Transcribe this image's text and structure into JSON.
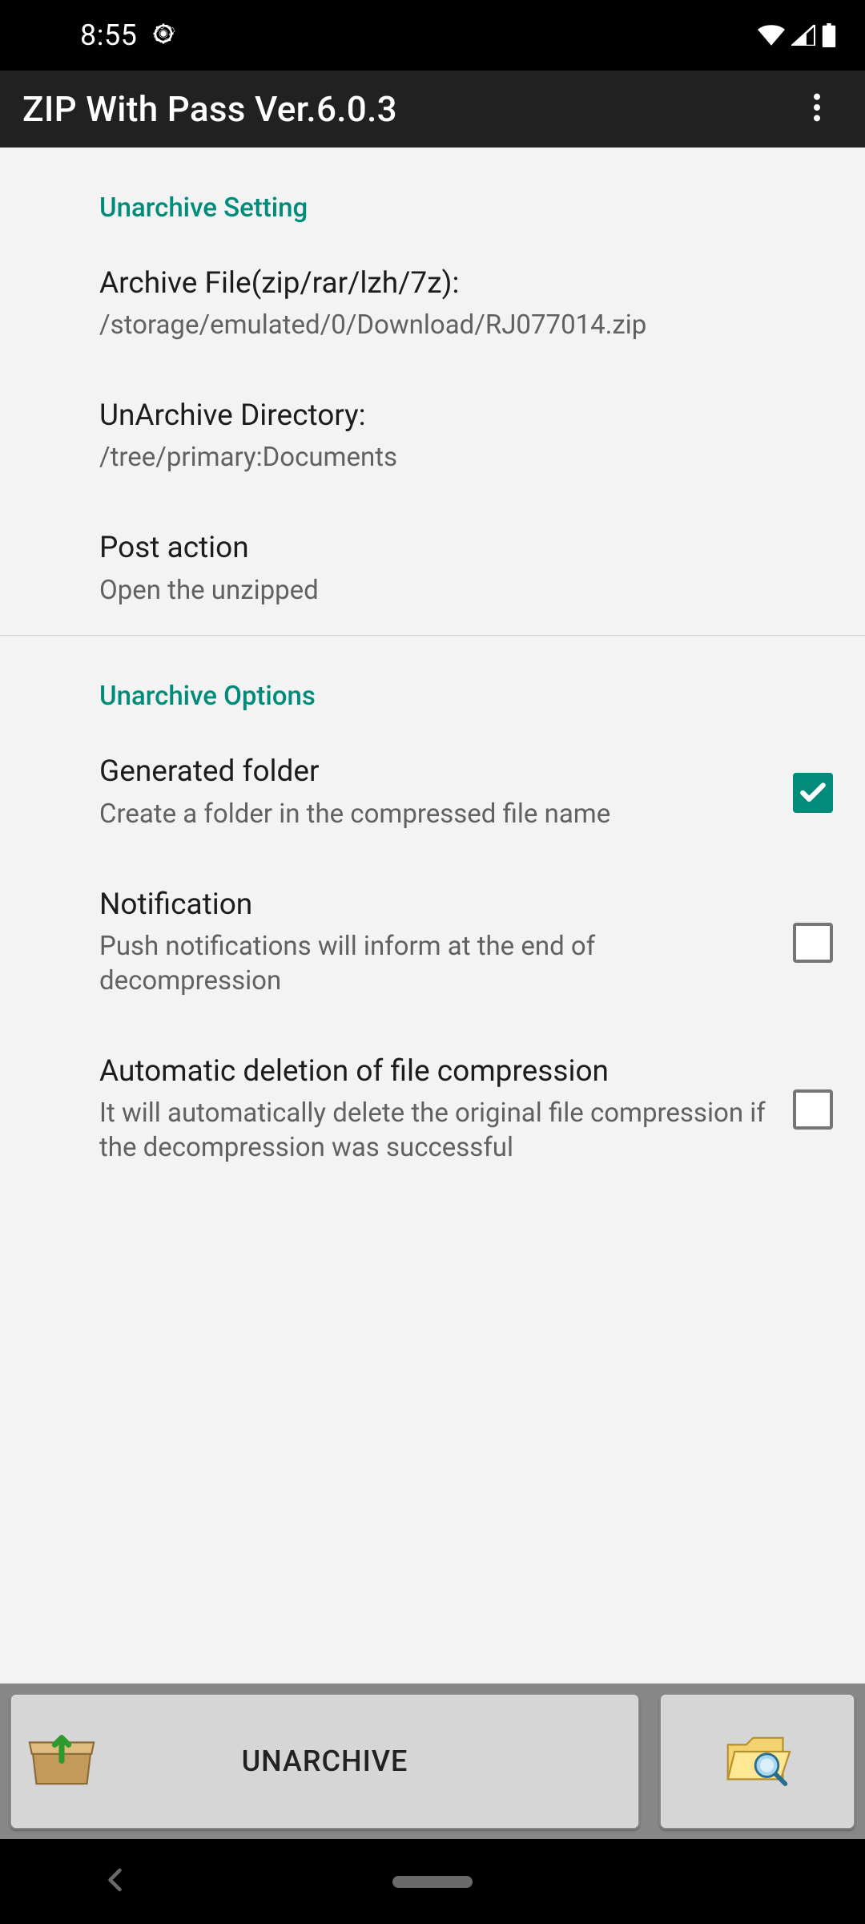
{
  "status_bar": {
    "time": "8:55"
  },
  "app_bar": {
    "title": "ZIP With Pass Ver.6.0.3"
  },
  "section1": {
    "header": "Unarchive Setting",
    "archive_file": {
      "title": "Archive File(zip/rar/lzh/7z):",
      "value": "/storage/emulated/0/Download/RJ077014.zip"
    },
    "unarchive_dir": {
      "title": "UnArchive Directory:",
      "value": "/tree/primary:Documents"
    },
    "post_action": {
      "title": "Post action",
      "value": "Open the unzipped"
    }
  },
  "section2": {
    "header": "Unarchive Options",
    "generated_folder": {
      "title": "Generated folder",
      "desc": "Create a folder in the compressed file name",
      "checked": true
    },
    "notification": {
      "title": "Notification",
      "desc": "Push notifications will inform at the end of decompression",
      "checked": false
    },
    "auto_delete": {
      "title": "Automatic deletion of file compression",
      "desc": "It will automatically delete the original file compression if the decompression was successful",
      "checked": false
    }
  },
  "bottom_bar": {
    "unarchive_label": "UNARCHIVE"
  }
}
